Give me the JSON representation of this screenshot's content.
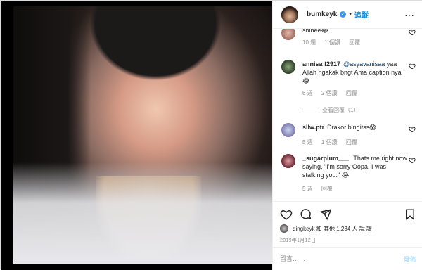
{
  "header": {
    "username": "bumkeyk",
    "dot": "•",
    "follow_label": "追蹤",
    "more": "···"
  },
  "comments": [
    {
      "user": "",
      "text": "shinee",
      "meta": [
        "10 週",
        "1 個讚",
        "回覆"
      ]
    },
    {
      "user": "annisa f2917",
      "mention": "@asyavanisaa",
      "text": "yaa Allah ngakak bngt Ama caption nya😂",
      "meta": [
        "6 週",
        "2 個讚",
        "回覆"
      ],
      "replies_label": "查看回覆（1）"
    },
    {
      "user": "sllw.ptr",
      "text": "Drakor bingitss😱",
      "meta": [
        "5 週",
        "1 個讚",
        "回覆"
      ]
    },
    {
      "user": "_sugarplum___",
      "text": "Thats me right now saying, \"I'm sorry Oopa, I was stalking you.\" 😭",
      "meta": [
        "5 週",
        "回覆"
      ]
    }
  ],
  "likes_text": "dingkeyk 和 其他 1,234 人 說 讚",
  "date": "2019年1月12日",
  "composer": {
    "placeholder": "留言……",
    "post_label": "發佈"
  },
  "colors": {
    "link": "#0095f6",
    "muted": "#8e8e8e",
    "border": "#dbdbdb"
  }
}
